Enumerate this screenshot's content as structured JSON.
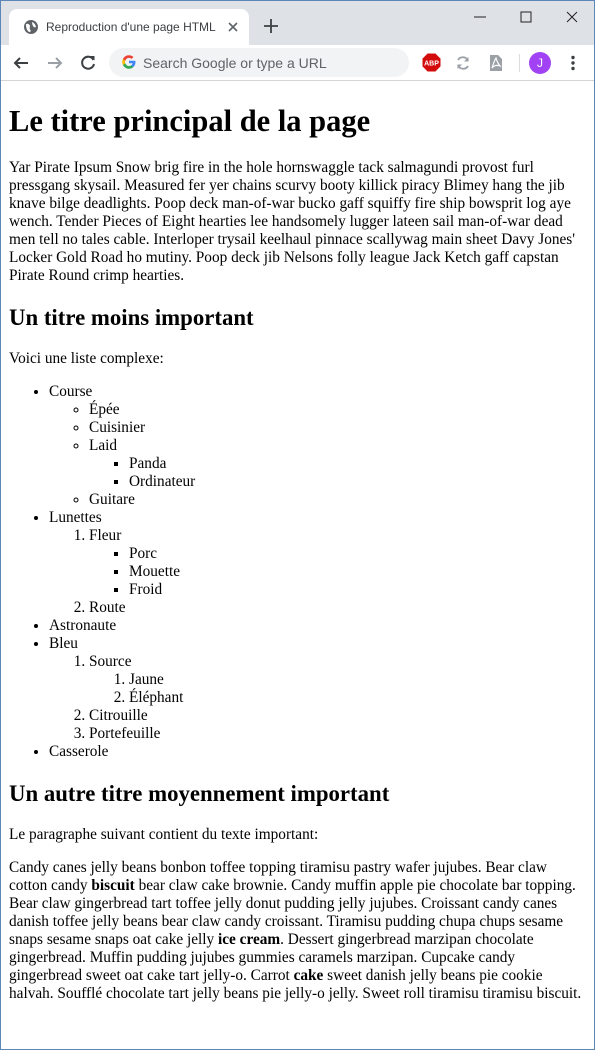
{
  "browser": {
    "tab": {
      "title": "Reproduction d'une page HTML"
    },
    "omnibox": {
      "placeholder": "Search Google or type a URL"
    },
    "extensions": {
      "abp_label": "ABP"
    },
    "profile": {
      "initial": "J"
    }
  },
  "page": {
    "h1": "Le titre principal de la page",
    "intro": "Yar Pirate Ipsum Snow brig fire in the hole hornswaggle tack salmagundi provost furl pressgang skysail. Measured fer yer chains scurvy booty killick piracy Blimey hang the jib knave bilge deadlights. Poop deck man-of-war bucko gaff squiffy fire ship bowsprit log aye wench. Tender Pieces of Eight hearties lee handsomely lugger lateen sail man-of-war dead men tell no tales cable. Interloper trysail keelhaul pinnace scallywag main sheet Davy Jones' Locker Gold Road ho mutiny. Poop deck jib Nelsons folly league Jack Ketch gaff capstan Pirate Round crimp hearties.",
    "h2_1": "Un titre moins important",
    "list_intro": "Voici une liste complexe:",
    "list": {
      "course": "Course",
      "course_items": [
        "Épée",
        "Cuisinier",
        "Laid",
        "Guitare"
      ],
      "laid_items": [
        "Panda",
        "Ordinateur"
      ],
      "lunettes": "Lunettes",
      "fleur": "Fleur",
      "fleur_items": [
        "Porc",
        "Mouette",
        "Froid"
      ],
      "route": "Route",
      "astronaute": "Astronaute",
      "bleu": "Bleu",
      "source": "Source",
      "source_items": [
        "Jaune",
        "Éléphant"
      ],
      "citrouille": "Citrouille",
      "portefeuille": "Portefeuille",
      "casserole": "Casserole"
    },
    "h2_2": "Un autre titre moyennement important",
    "important_intro": "Le paragraphe suivant contient du texte important:",
    "candy": {
      "t1": "Candy canes jelly beans bonbon toffee topping tiramisu pastry wafer jujubes. Bear claw cotton candy ",
      "b1": "biscuit",
      "t2": " bear claw cake brownie. Candy muffin apple pie chocolate bar topping. Bear claw gingerbread tart toffee jelly donut pudding jelly jujubes. Croissant candy canes danish toffee jelly beans bear claw candy croissant. Tiramisu pudding chupa chups sesame snaps sesame snaps oat cake jelly ",
      "b2": "ice cream",
      "t3": ". Dessert gingerbread marzipan chocolate gingerbread. Muffin pudding jujubes gummies caramels marzipan. Cupcake candy gingerbread sweet oat cake tart jelly-o. Carrot ",
      "b3": "cake",
      "t4": " sweet danish jelly beans pie cookie halvah. Soufflé chocolate tart jelly beans pie jelly-o jelly. Sweet roll tiramisu tiramisu biscuit."
    }
  }
}
